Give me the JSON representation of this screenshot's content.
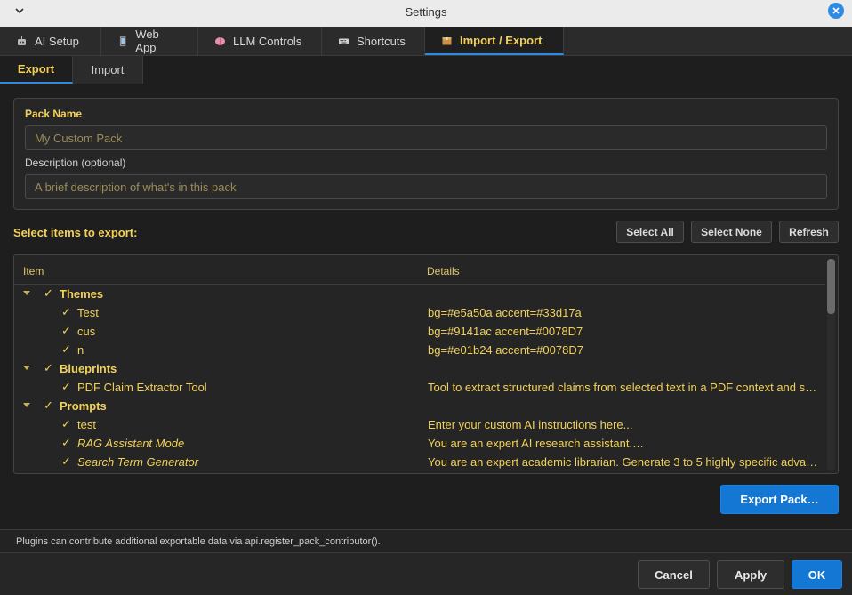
{
  "window": {
    "title": "Settings"
  },
  "tabs": [
    {
      "label": "AI Setup",
      "icon": "robot-icon"
    },
    {
      "label": "Web App",
      "icon": "phone-icon"
    },
    {
      "label": "LLM Controls",
      "icon": "brain-icon"
    },
    {
      "label": "Shortcuts",
      "icon": "keyboard-icon"
    },
    {
      "label": "Import / Export",
      "icon": "package-icon",
      "active": true
    }
  ],
  "subtabs": [
    {
      "label": "Export",
      "active": true
    },
    {
      "label": "Import"
    }
  ],
  "pack": {
    "name_label": "Pack Name",
    "name_placeholder": "My Custom Pack",
    "desc_label": "Description (optional)",
    "desc_placeholder": "A brief description of what's in this pack"
  },
  "select": {
    "heading": "Select items to export:",
    "select_all": "Select All",
    "select_none": "Select None",
    "refresh": "Refresh"
  },
  "tree": {
    "col_item": "Item",
    "col_details": "Details",
    "check_glyph": "✓",
    "groups": [
      {
        "name": "Themes",
        "items": [
          {
            "name": "Test",
            "details": "bg=#e5a50a accent=#33d17a"
          },
          {
            "name": "cus",
            "details": "bg=#9141ac accent=#0078D7"
          },
          {
            "name": "n",
            "details": "bg=#e01b24 accent=#0078D7"
          }
        ]
      },
      {
        "name": "Blueprints",
        "items": [
          {
            "name": "PDF Claim Extractor Tool",
            "details": "Tool to extract structured claims from selected text in a PDF context and s…"
          }
        ]
      },
      {
        "name": "Prompts",
        "items": [
          {
            "name": "test",
            "details": "Enter your custom AI instructions here..."
          },
          {
            "name": "RAG Assistant Mode",
            "details": "You are an expert AI research assistant.…",
            "italic": true
          },
          {
            "name": "Search Term Generator",
            "details": "You are an expert academic librarian. Generate 3 to 5 highly specific adva…",
            "italic": true
          }
        ]
      }
    ]
  },
  "export_button": "Export Pack…",
  "footer_note": "Plugins can contribute additional exportable data via api.register_pack_contributor().",
  "dialog": {
    "cancel": "Cancel",
    "apply": "Apply",
    "ok": "OK"
  },
  "colors": {
    "accent": "#f2d15a",
    "primary": "#1477d4",
    "background": "#1e1e1e"
  }
}
